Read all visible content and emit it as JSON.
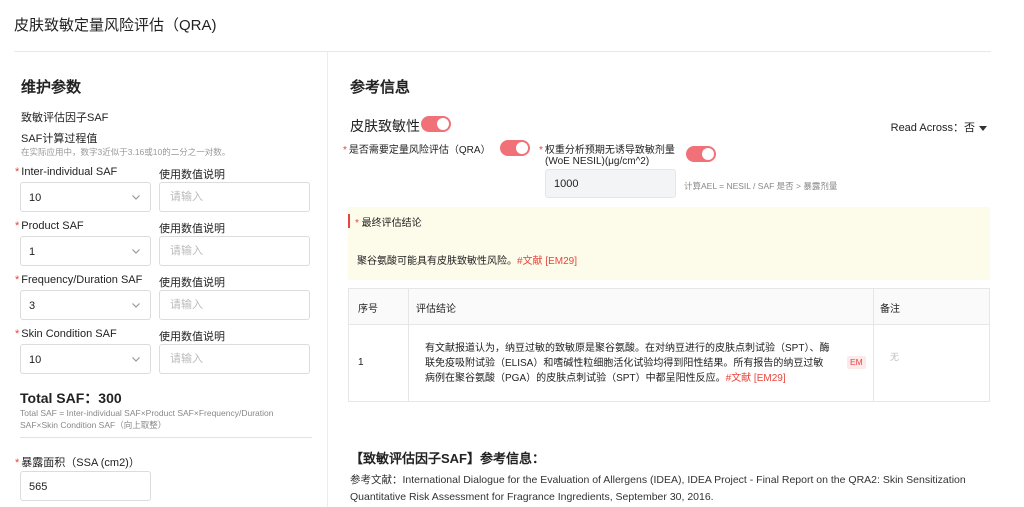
{
  "page": {
    "title": "皮肤致敏定量风险评估（QRA)"
  },
  "left": {
    "title": "维护参数",
    "factor_title": "致敏评估因子SAF",
    "calc_title": "SAF计算过程值",
    "calc_hint": "在实际应用中，数字3近似于3.16或10的二分之一对数。",
    "usage_label": "使用数值说明",
    "placeholder": "请输入",
    "saf": [
      {
        "label": "Inter-individual SAF",
        "value": "10"
      },
      {
        "label": "Product SAF",
        "value": "1"
      },
      {
        "label": "Frequency/Duration SAF",
        "value": "3"
      },
      {
        "label": "Skin Condition SAF",
        "value": "10"
      }
    ],
    "total_saf": "Total SAF：300",
    "total_desc": "Total SAF = Inter-individual SAF×Product SAF×Frequency/Duration SAF×Skin Condition SAF（向上取整）",
    "ssa_label": "暴露面积（SSA (cm2)）",
    "ssa_value": "565"
  },
  "right": {
    "title": "参考信息",
    "skin_sens_label": "皮肤致敏性",
    "read_across_label": "Read Across：",
    "read_across_value": "否",
    "qra_needed_label": "是否需要定量风险评估（QRA）",
    "woe_label_1": "权重分析预期无诱导致敏剂量",
    "woe_label_2": "(WoE NESIL)(μg/cm^2)",
    "woe_value": "1000",
    "woe_note": "计算AEL = NESIL / SAF 是否 > 暴露剂量",
    "conclusion_title": "最终评估结论",
    "conclusion_text": "聚谷氨酸可能具有皮肤致敏性风险。",
    "conclusion_ref": "#文献 [EM29]",
    "table": {
      "headers": [
        "序号",
        "评估结论",
        "备注"
      ],
      "rows": [
        {
          "index": "1",
          "text": "有文献报道认为，纳豆过敏的致敏原是聚谷氨酸。在对纳豆进行的皮肤点刺试验（SPT）、酶联免疫吸附试验（ELISA）和嗜碱性粒细胞活化试验均得到阳性结果。所有报告的纳豆过敏病例在聚谷氨酸（PGA）的皮肤点刺试验（SPT）中都呈阳性反应。",
          "ref": "#文献 [EM29]",
          "badge": "EM",
          "remark": "无"
        }
      ]
    },
    "ref_title": "【致敏评估因子SAF】参考信息：",
    "ref_body": "参考文献：International Dialogue for the Evaluation of Allergens (IDEA), IDEA Project - Final Report on the QRA2: Skin Sensitization Quantitative Risk Assessment for Fragrance Ingredients, September 30, 2016."
  },
  "colors": {
    "accent": "#f07178",
    "required": "#e8453c",
    "conclusion_bg": "#fdfbe9"
  },
  "icons": {
    "select_chevron": "chevron-down-icon",
    "read_across_caret": "caret-down-icon"
  }
}
